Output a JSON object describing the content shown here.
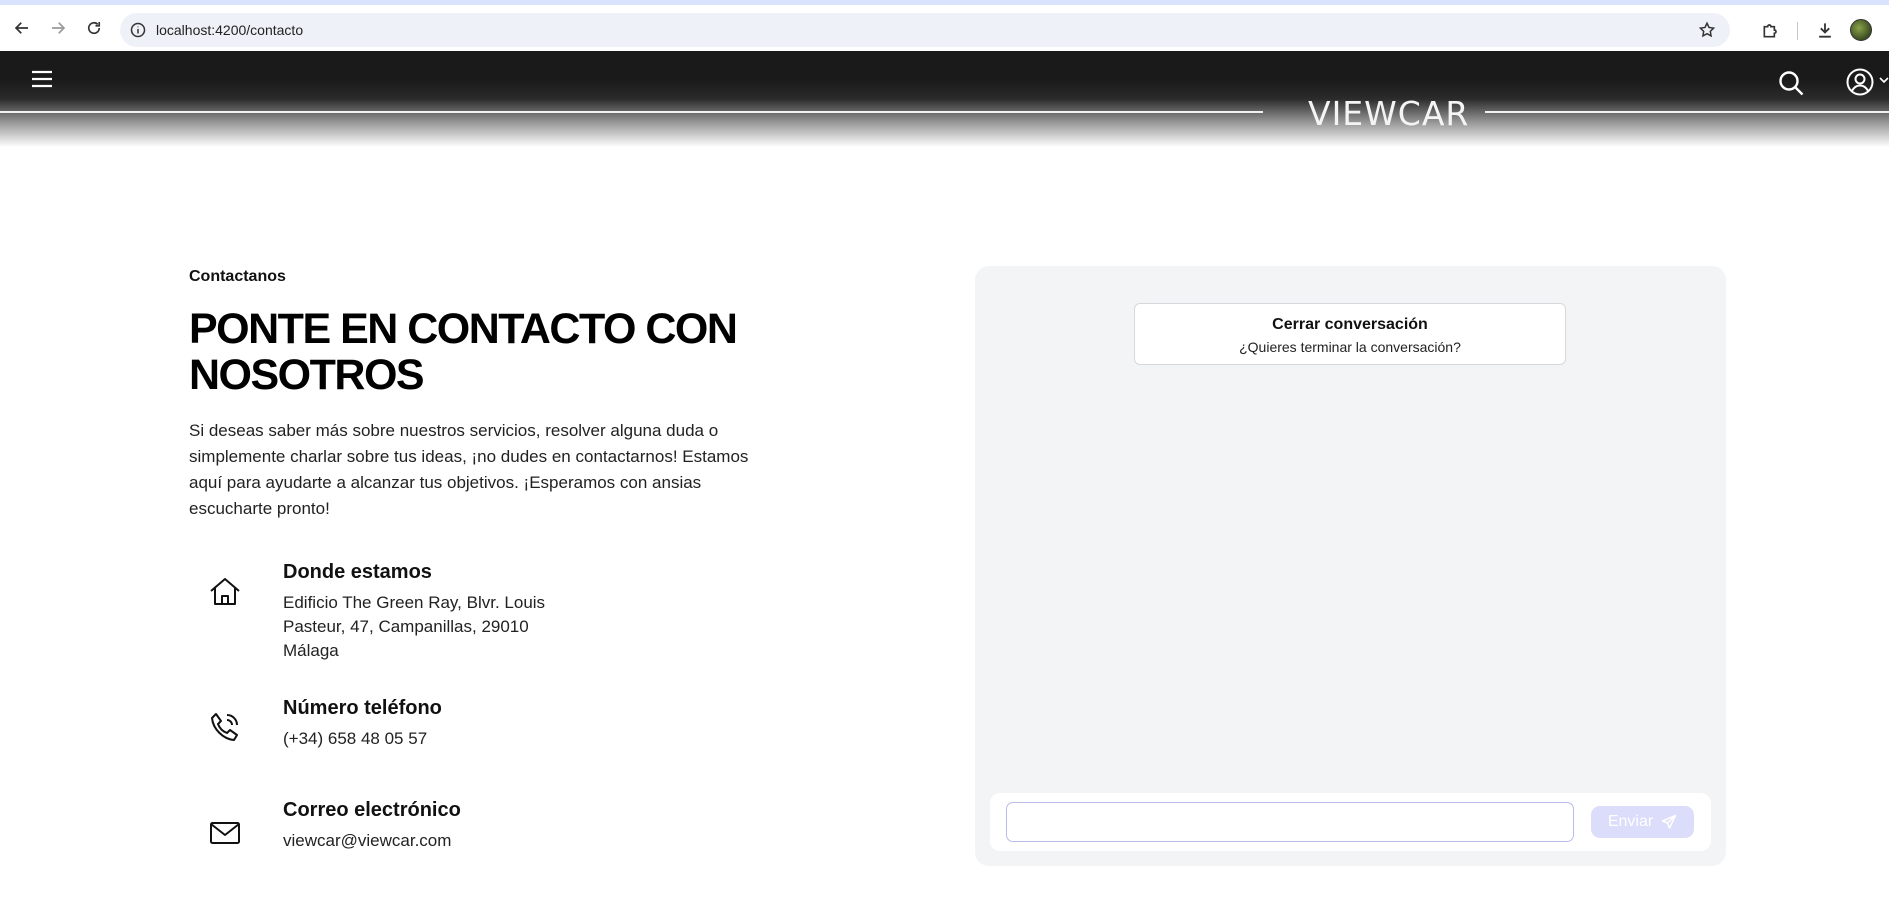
{
  "browser": {
    "url": "localhost:4200/contacto"
  },
  "header": {
    "logo_text": "VIEWCAR"
  },
  "contact": {
    "eyebrow": "Contactanos",
    "title": "PONTE EN CONTACTO CON NOSOTROS",
    "intro": "Si deseas saber más sobre nuestros servicios, resolver alguna duda o simplemente charlar sobre tus ideas, ¡no dudes en contactarnos! Estamos aquí para ayudarte a alcanzar tus objetivos. ¡Esperamos con ansias escucharte pronto!",
    "items": [
      {
        "icon": "home-icon",
        "title": "Donde estamos",
        "text": "Edificio The Green Ray, Blvr. Louis Pasteur, 47, Campanillas, 29010 Málaga"
      },
      {
        "icon": "phone-icon",
        "title": "Número teléfono",
        "text": "(+34) 658 48 05 57"
      },
      {
        "icon": "mail-icon",
        "title": "Correo electrónico",
        "text": "viewcar@viewcar.com"
      }
    ]
  },
  "chat": {
    "close_title": "Cerrar conversación",
    "close_subtitle": "¿Quieres terminar la conversación?",
    "input_value": "",
    "input_placeholder": "",
    "send_label": "Enviar"
  },
  "colors": {
    "header_dark": "#1a1a1a",
    "panel_bg": "#f3f4f6",
    "send_button_bg": "#dcdcfb",
    "input_border": "#b8bde8"
  }
}
